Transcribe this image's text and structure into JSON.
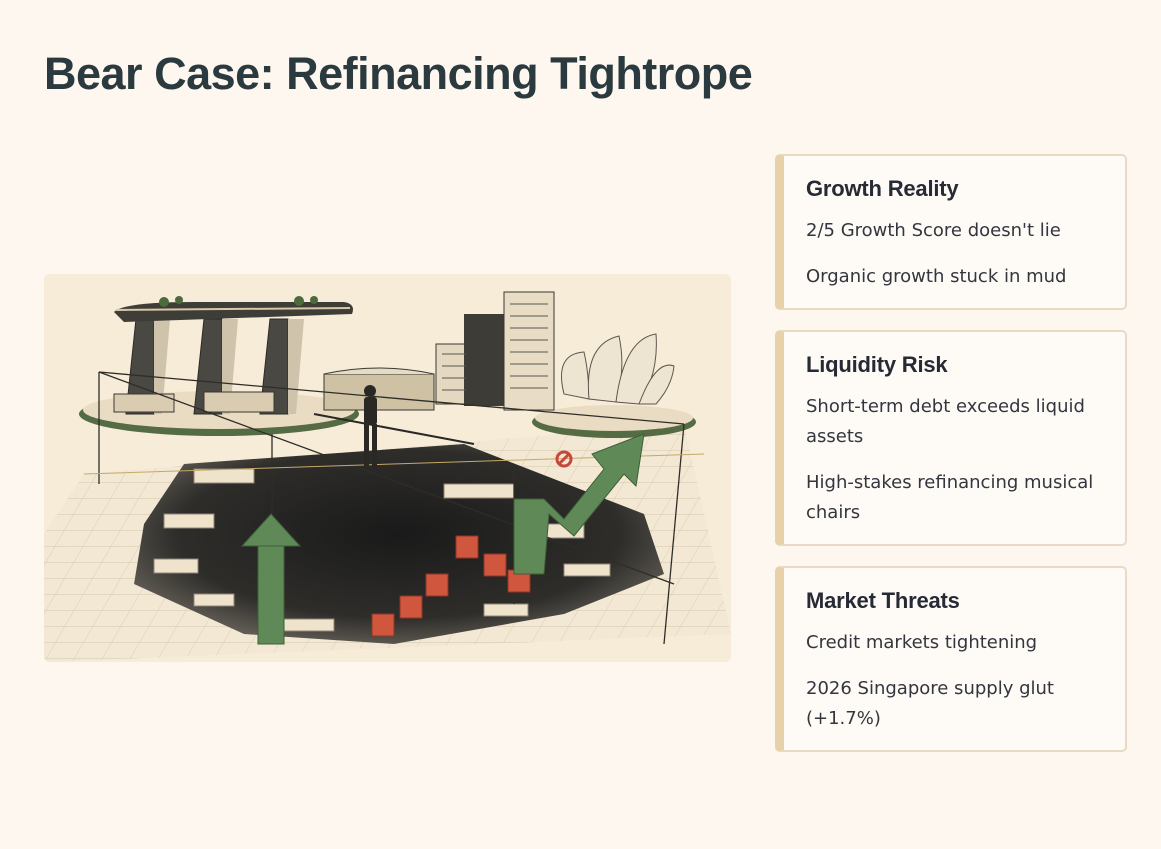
{
  "title": "Bear Case: Refinancing Tightrope",
  "illustration": {
    "subject": "tightrope-walker-over-sinkhole-singapore-skyline"
  },
  "cards": [
    {
      "title": "Growth Reality",
      "items": [
        "2/5 Growth Score doesn't lie",
        "Organic growth stuck in mud"
      ]
    },
    {
      "title": "Liquidity Risk",
      "items": [
        "Short-term debt exceeds liquid assets",
        "High-stakes refinancing musical chairs"
      ]
    },
    {
      "title": "Market Threats",
      "items": [
        "Credit markets tightening",
        "2026 Singapore supply glut (+1.7%)"
      ]
    }
  ],
  "colors": {
    "background": "#fdf7f0",
    "title": "#2b3a3e",
    "card_accent": "#e6d1a8",
    "card_border": "#ead9c4",
    "green_arrow": "#5f8a58",
    "red_blocks": "#d0563e"
  }
}
